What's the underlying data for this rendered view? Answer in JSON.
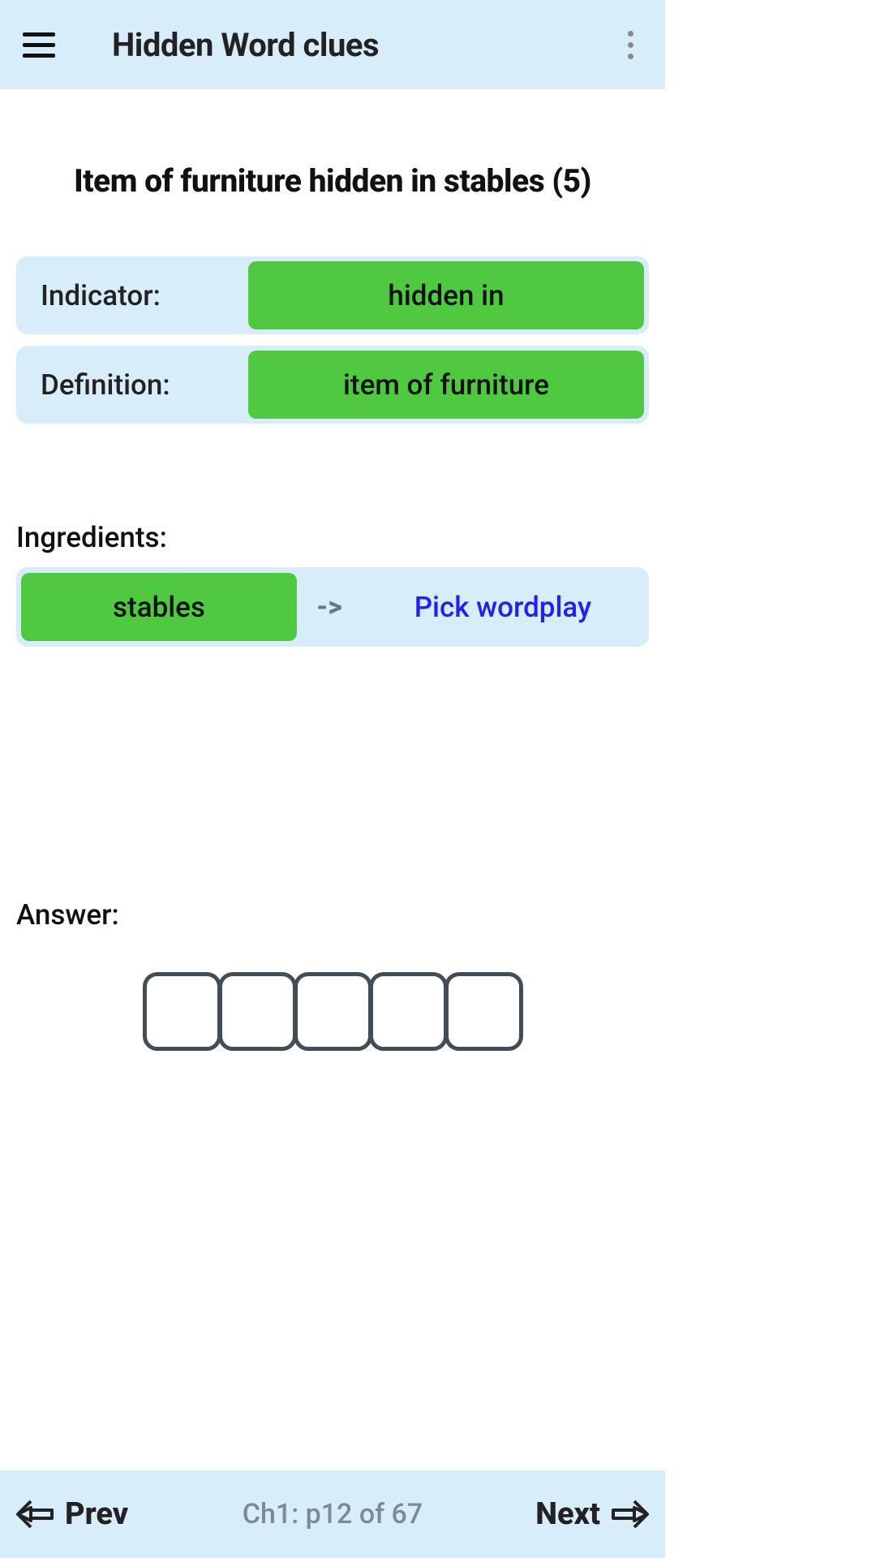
{
  "header": {
    "title": "Hidden Word clues"
  },
  "clue": {
    "text": "Item of furniture hidden in stables (5)"
  },
  "rows": {
    "indicator_label": "Indicator:",
    "indicator_value": "hidden in",
    "definition_label": "Definition:",
    "definition_value": "item of furniture"
  },
  "ingredients": {
    "label": "Ingredients:",
    "chip": "stables",
    "arrow": "->",
    "action": "Pick wordplay"
  },
  "answer": {
    "label": "Answer:",
    "length": 5
  },
  "footer": {
    "prev": "Prev",
    "next": "Next",
    "page": "Ch1: p12 of 67"
  }
}
